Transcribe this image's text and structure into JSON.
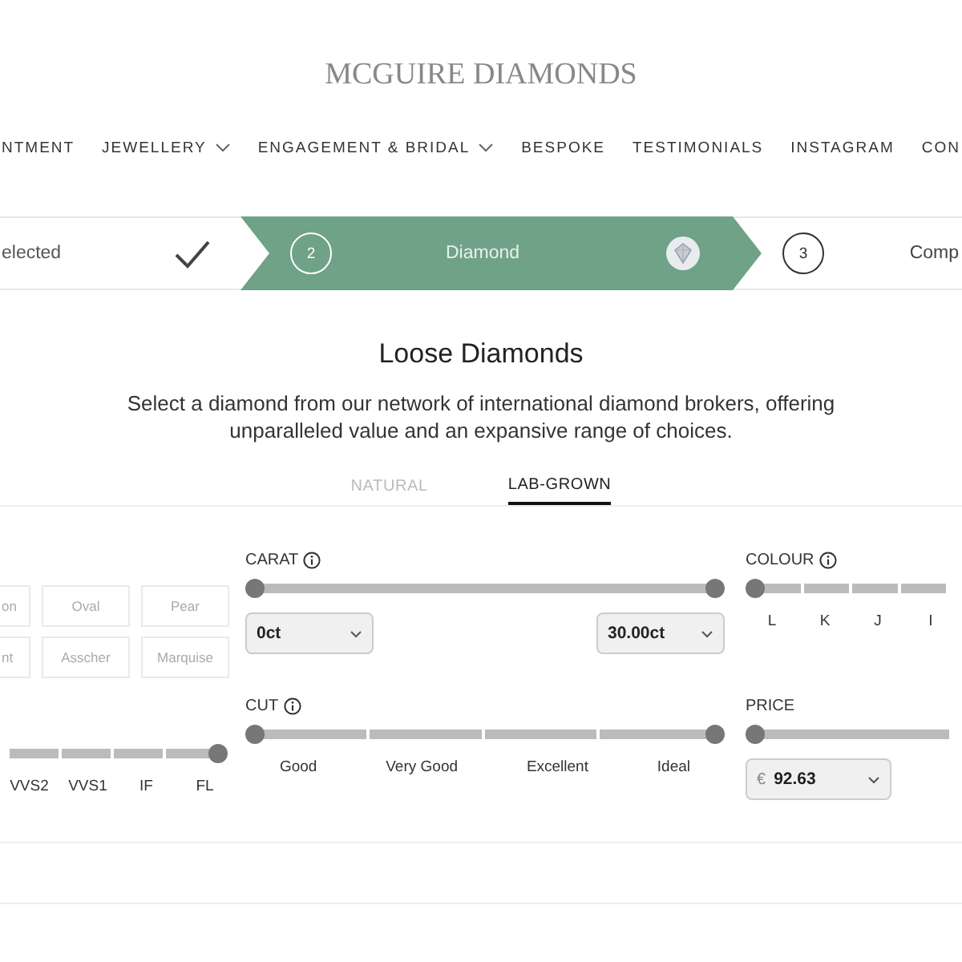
{
  "header": {
    "logo": "MCGUIRE DIAMONDS"
  },
  "nav": [
    {
      "label": "NTMENT",
      "dropdown": false
    },
    {
      "label": "JEWELLERY",
      "dropdown": true
    },
    {
      "label": "ENGAGEMENT & BRIDAL",
      "dropdown": true
    },
    {
      "label": "BESPOKE",
      "dropdown": false
    },
    {
      "label": "TESTIMONIALS",
      "dropdown": false
    },
    {
      "label": "INSTAGRAM",
      "dropdown": false
    },
    {
      "label": "CON",
      "dropdown": false
    }
  ],
  "steps": [
    {
      "kind": "done",
      "label": "elected"
    },
    {
      "kind": "current",
      "number": "2",
      "label": "Diamond"
    },
    {
      "kind": "upcoming",
      "number": "3",
      "label": "Comp"
    }
  ],
  "page": {
    "title": "Loose Diamonds",
    "intro": "Select a diamond from our network of international diamond brokers, offering unparalleled value and an expansive range of choices."
  },
  "tabs": [
    {
      "label": "NATURAL",
      "selected": false
    },
    {
      "label": "LAB-GROWN",
      "selected": true
    }
  ],
  "shapes": [
    "on",
    "Oval",
    "Pear",
    "nt",
    "Asscher",
    "Marquise"
  ],
  "filters": [
    {
      "kind": "carat",
      "title": "CARAT",
      "info": true,
      "handles": [
        {
          "level": 0
        },
        {
          "level": 1
        }
      ],
      "selects": [
        {
          "value": "0ct"
        },
        {
          "value": "30.00ct"
        }
      ]
    },
    {
      "kind": "ticks",
      "title": "COLOUR",
      "info": true,
      "handles": [
        {
          "level": 0
        }
      ],
      "labels": [
        "L",
        "K",
        "J",
        "I"
      ]
    },
    {
      "kind": "ticks",
      "handles": [
        {
          "level": 1
        }
      ],
      "labels": [
        "VVS2",
        "VVS1",
        "IF",
        "FL"
      ]
    },
    {
      "kind": "ticks",
      "title": "CUT",
      "info": true,
      "handles": [
        {
          "level": 0
        },
        {
          "level": 1
        }
      ],
      "labels": [
        "Good",
        "Very Good",
        "Excellent",
        "Ideal"
      ]
    },
    {
      "kind": "price",
      "title": "PRICE",
      "info": false,
      "handles": [
        {
          "level": 0
        }
      ],
      "selects": [
        {
          "currency": "€",
          "value": "92.63"
        }
      ]
    }
  ]
}
